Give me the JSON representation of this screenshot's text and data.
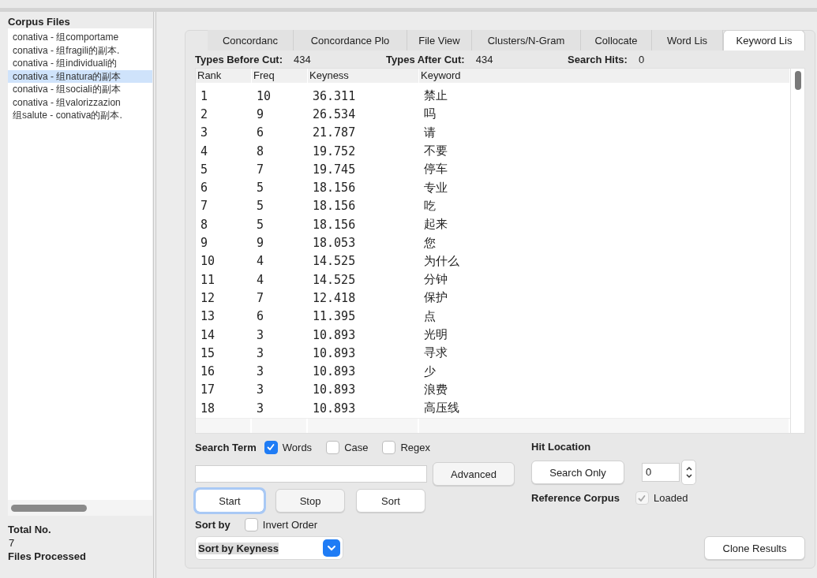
{
  "corpus_panel": {
    "title": "Corpus Files",
    "files": [
      {
        "name": "conativa - 组comportame",
        "selected": false
      },
      {
        "name": "conativa - 组fragili的副本.",
        "selected": false
      },
      {
        "name": "conativa - 组individuali的",
        "selected": false
      },
      {
        "name": "conativa - 组natura的副本",
        "selected": true
      },
      {
        "name": "conativa - 组sociali的副本",
        "selected": false
      },
      {
        "name": "conativa - 组valorizzazion",
        "selected": false
      },
      {
        "name": "组salute - conativa的副本.",
        "selected": false
      }
    ],
    "total_label": "Total No.",
    "total_value": "7",
    "files_processed_label": "Files Processed"
  },
  "tabs": [
    {
      "label": "Concordanc",
      "selected": false
    },
    {
      "label": "Concordance Plo",
      "selected": false
    },
    {
      "label": "File View",
      "selected": false
    },
    {
      "label": "Clusters/N-Gram",
      "selected": false
    },
    {
      "label": "Collocate",
      "selected": false
    },
    {
      "label": "Word Lis",
      "selected": false
    },
    {
      "label": "Keyword Lis",
      "selected": true
    }
  ],
  "stats": [
    {
      "label": "Types Before Cut:",
      "value": "434"
    },
    {
      "label": "Types After Cut:",
      "value": "434"
    },
    {
      "label": "Search Hits:",
      "value": "0"
    }
  ],
  "table": {
    "columns": [
      "Rank",
      "Freq",
      "Keyness",
      "Keyword"
    ],
    "rows": [
      [
        "1",
        "10",
        "36.311",
        "禁止"
      ],
      [
        "2",
        "9",
        "26.534",
        "吗"
      ],
      [
        "3",
        "6",
        "21.787",
        "请"
      ],
      [
        "4",
        "8",
        "19.752",
        "不要"
      ],
      [
        "5",
        "7",
        "19.745",
        "停车"
      ],
      [
        "6",
        "5",
        "18.156",
        "专业"
      ],
      [
        "7",
        "5",
        "18.156",
        "吃"
      ],
      [
        "8",
        "5",
        "18.156",
        "起来"
      ],
      [
        "9",
        "9",
        "18.053",
        "您"
      ],
      [
        "10",
        "4",
        "14.525",
        "为什么"
      ],
      [
        "11",
        "4",
        "14.525",
        "分钟"
      ],
      [
        "12",
        "7",
        "12.418",
        "保护"
      ],
      [
        "13",
        "6",
        "11.395",
        "点"
      ],
      [
        "14",
        "3",
        "10.893",
        "光明"
      ],
      [
        "15",
        "3",
        "10.893",
        "寻求"
      ],
      [
        "16",
        "3",
        "10.893",
        "少"
      ],
      [
        "17",
        "3",
        "10.893",
        "浪费"
      ],
      [
        "18",
        "3",
        "10.893",
        "高压线"
      ]
    ]
  },
  "search": {
    "label": "Search Term",
    "options": [
      {
        "label": "Words",
        "checked": true
      },
      {
        "label": "Case",
        "checked": false
      },
      {
        "label": "Regex",
        "checked": false
      }
    ],
    "advanced_button": "Advanced"
  },
  "buttons": [
    {
      "label": "Start",
      "focused": true
    },
    {
      "label": "Stop",
      "focused": false
    },
    {
      "label": "Sort",
      "focused": false
    }
  ],
  "sort": {
    "label": "Sort by",
    "invert": {
      "label": "Invert Order",
      "checked": false
    },
    "value": "Sort by Keyness"
  },
  "hit_location": {
    "label": "Hit Location",
    "button": "Search Only",
    "value": "0"
  },
  "reference_corpus": {
    "label": "Reference Corpus",
    "loaded": {
      "label": "Loaded",
      "checked": true,
      "disabled": true
    }
  },
  "clone_button": "Clone Results"
}
